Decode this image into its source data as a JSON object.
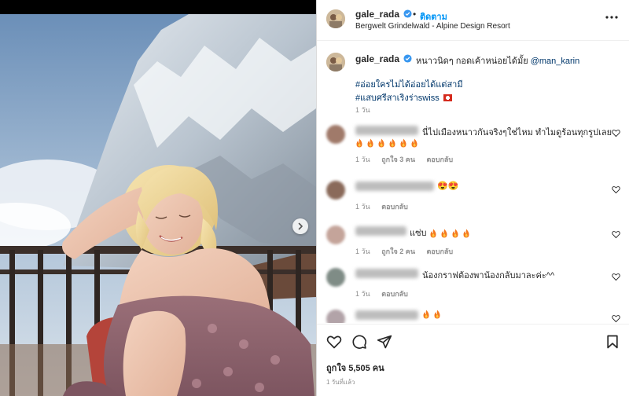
{
  "post": {
    "username": "gale_rada",
    "follow_label": "ติดตาม",
    "separator": "•",
    "location": "Bergwelt Grindelwald - Alpine Design Resort"
  },
  "caption": {
    "username": "gale_rada",
    "text": "หนาวนิดๆ กอดเค้าหน่อยได้มั้ย ",
    "mention": "@man_karin",
    "hashtag_1": "#อ่อยใครไม่ได้อ่อยได้แต่สามี",
    "hashtag_2": "#แสบศรีสาเริงร่าswiss",
    "flag": "🇨🇭",
    "time": "1 วัน"
  },
  "comments": [
    {
      "text": "นี่ไปเมืองหนาวกันจริงๆใช่ไหม ทำไมดูร้อนทุกรูปเลย",
      "fire_count": 6,
      "time": "1 วัน",
      "likes": "ถูกใจ 3 คน",
      "reply": "ตอบกลับ"
    },
    {
      "text": "😍😍",
      "fire_count": 0,
      "time": "1 วัน",
      "likes": "",
      "reply": "ตอบกลับ"
    },
    {
      "text": "แซ่บ",
      "fire_count": 4,
      "time": "1 วัน",
      "likes": "ถูกใจ 2 คน",
      "reply": "ตอบกลับ"
    },
    {
      "text": "น้องกราฟต้องพาน้องกลับมาละค่ะ^^",
      "fire_count": 0,
      "time": "1 วัน",
      "likes": "",
      "reply": "ตอบกลับ"
    },
    {
      "text": "",
      "fire_count": 2,
      "time": "",
      "likes": "",
      "reply": ""
    }
  ],
  "footer": {
    "likes": "ถูกใจ 5,505 คน",
    "posted": "1 วันที่แล้ว"
  },
  "icons": {
    "more": "more-horizontal-icon",
    "like": "heart-outline-icon",
    "comment": "comment-bubble-icon",
    "share": "paper-plane-icon",
    "save": "bookmark-icon",
    "next": "chevron-right-icon",
    "verified": "verified-badge-icon"
  },
  "colors": {
    "accent": "#0095f6",
    "link": "#00376b",
    "verified": "#3897f0",
    "muted": "#8e8e8e"
  }
}
